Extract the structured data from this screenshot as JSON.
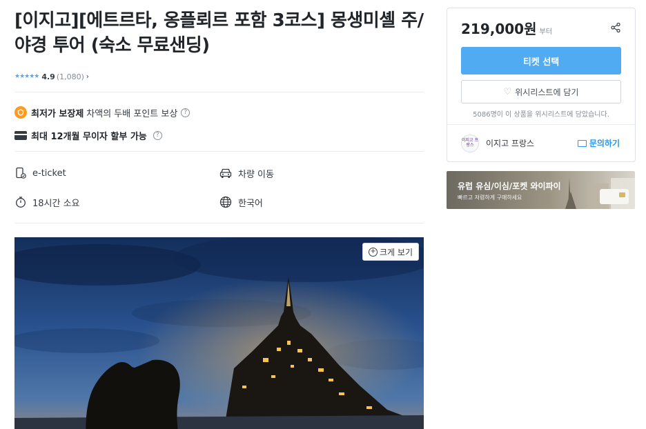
{
  "product": {
    "title": "[이지고][에트르타, 옹플뢰르 포함 3코스] 몽생미셸 주/야경 투어 (숙소 무료샌딩)",
    "rating": {
      "stars": "★★★★★",
      "score": "4.9",
      "count": "(1,080)",
      "chevron": "›",
      "star_color": "#51abf3"
    },
    "benefits": [
      {
        "icon": "coin-icon",
        "strong": "최저가 보장제",
        "text": "차액의 두배 포인트 보상"
      },
      {
        "icon": "credit-card-icon",
        "strong": "최대 12개월 무이자 할부 가능",
        "text": ""
      }
    ],
    "help_symbol": "?",
    "coin_symbol": "○",
    "features": [
      {
        "icon": "mobile-ticket-icon",
        "label": "e-ticket"
      },
      {
        "icon": "car-icon",
        "label": "차량 이동"
      },
      {
        "icon": "timer-icon",
        "label": "18시간 소요"
      },
      {
        "icon": "globe-icon",
        "label": "한국어"
      }
    ],
    "zoom_button": {
      "plus": "+",
      "label": "크게 보기"
    }
  },
  "purchase": {
    "price": "219,000원",
    "price_suffix": "부터",
    "ticket_button": "티켓 선택",
    "wishlist_button": "위시리스트에 담기",
    "wishlist_heart": "♡",
    "wishlist_count": "5086명이 이 상품을 위시리스트에 담았습니다.",
    "seller_name": "이지고 프랑스",
    "seller_avatar": "이지고 프랑스",
    "inquiry_label": "문의하기",
    "accent_color": "#51abf3"
  },
  "banner": {
    "title": "유럽 유심/이심/포켓 와이파이",
    "subtitle": "빠르고 저렴하게 구매하세요"
  }
}
